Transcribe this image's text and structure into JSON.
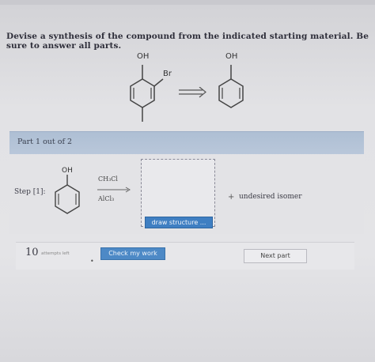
{
  "question": {
    "text": "Devise a synthesis of the compound from the indicated starting material. Be sure to answer all parts."
  },
  "scheme": {
    "start_oh": "OH",
    "start_br": "Br",
    "product_oh": "OH"
  },
  "part": {
    "label": "Part 1 out of 2"
  },
  "step": {
    "label": "Step [1]:",
    "reactant_oh": "OH",
    "reagent_top": "CH₃Cl",
    "reagent_bottom": "AlCl₃",
    "draw_button": "draw structure ...",
    "plus": "+",
    "byproduct": "undesired isomer"
  },
  "footer": {
    "attempts_count": "10",
    "attempts_label": "attempts left",
    "check_button": "Check my work",
    "next_button": "Next part"
  },
  "colors": {
    "part_bar": "#b4c3d8",
    "primary_button": "#3f7fc2"
  }
}
